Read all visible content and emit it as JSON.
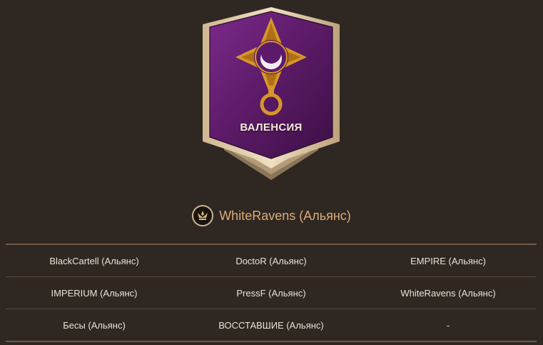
{
  "territory": {
    "name": "ВАЛЕНСИЯ",
    "emblem": "crescent-moon-eye-icon"
  },
  "owner": {
    "icon": "crown-wings-icon",
    "name": "WhiteRavens (Альянс)"
  },
  "participants": {
    "rows": [
      [
        "BlackCartell (Альянс)",
        "DoctoR (Альянс)",
        "EMPIRE (Альянс)"
      ],
      [
        "IMPERIUM (Альянс)",
        "PressF (Альянс)",
        "WhiteRavens (Альянс)"
      ],
      [
        "Бесы (Альянс)",
        "ВОССТАВШИЕ (Альянс)",
        "-"
      ]
    ]
  },
  "colors": {
    "background": "#2f2721",
    "banner": "#5a1a66",
    "gold": "#d6962a",
    "owner_text": "#d9ad7a"
  }
}
